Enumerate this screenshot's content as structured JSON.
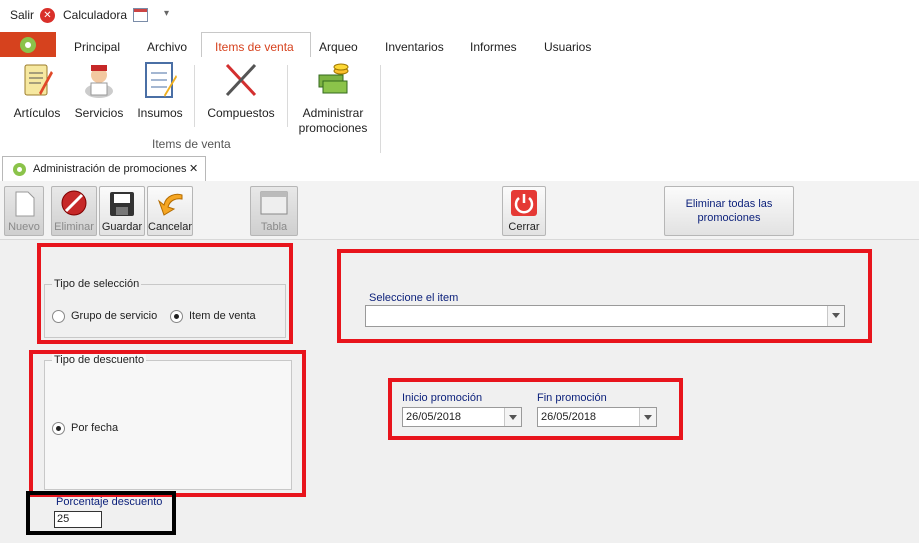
{
  "quick_access": {
    "salir": "Salir",
    "calculadora": "Calculadora",
    "dropdown": "▾"
  },
  "tabs": [
    "Principal",
    "Archivo",
    "Items de venta",
    "Arqueo",
    "Inventarios",
    "Informes",
    "Usuarios"
  ],
  "active_tab": "Items de venta",
  "ribbon": {
    "items": [
      {
        "label": "Artículos",
        "icon": "clipboard-icon"
      },
      {
        "label": "Servicios",
        "icon": "waiter-icon"
      },
      {
        "label": "Insumos",
        "icon": "checklist-icon"
      },
      {
        "label": "Compuestos",
        "icon": "tools-icon"
      },
      {
        "label": "Administrar",
        "label2": "promociones",
        "icon": "money-icon"
      }
    ],
    "group_label": "Items de venta"
  },
  "doc_tab": {
    "title": "Administración de promociones",
    "close": "✕"
  },
  "toolbar": {
    "nuevo": "Nuevo",
    "eliminar": "Eliminar",
    "guardar": "Guardar",
    "cancelar": "Cancelar",
    "tabla": "Tabla",
    "cerrar": "Cerrar",
    "eliminar_todas_1": "Eliminar todas las",
    "eliminar_todas_2": "promociones"
  },
  "form": {
    "tipo_seleccion": {
      "label": "Tipo de selección",
      "options": [
        "Grupo de servicio",
        "Item de venta"
      ],
      "selected": "Item de venta"
    },
    "seleccione_item": {
      "label": "Seleccione el item",
      "value": ""
    },
    "tipo_descuento": {
      "label": "Tipo de descuento",
      "option": "Por fecha"
    },
    "inicio": {
      "label": "Inicio promoción",
      "value": "26/05/2018"
    },
    "fin": {
      "label": "Fin promoción",
      "value": "26/05/2018"
    },
    "porcentaje": {
      "label": "Porcentaje descuento",
      "value": "25"
    }
  },
  "colors": {
    "highlight": "#e8141c",
    "accent": "#d6421e",
    "active_tab_text": "#d6421e"
  }
}
